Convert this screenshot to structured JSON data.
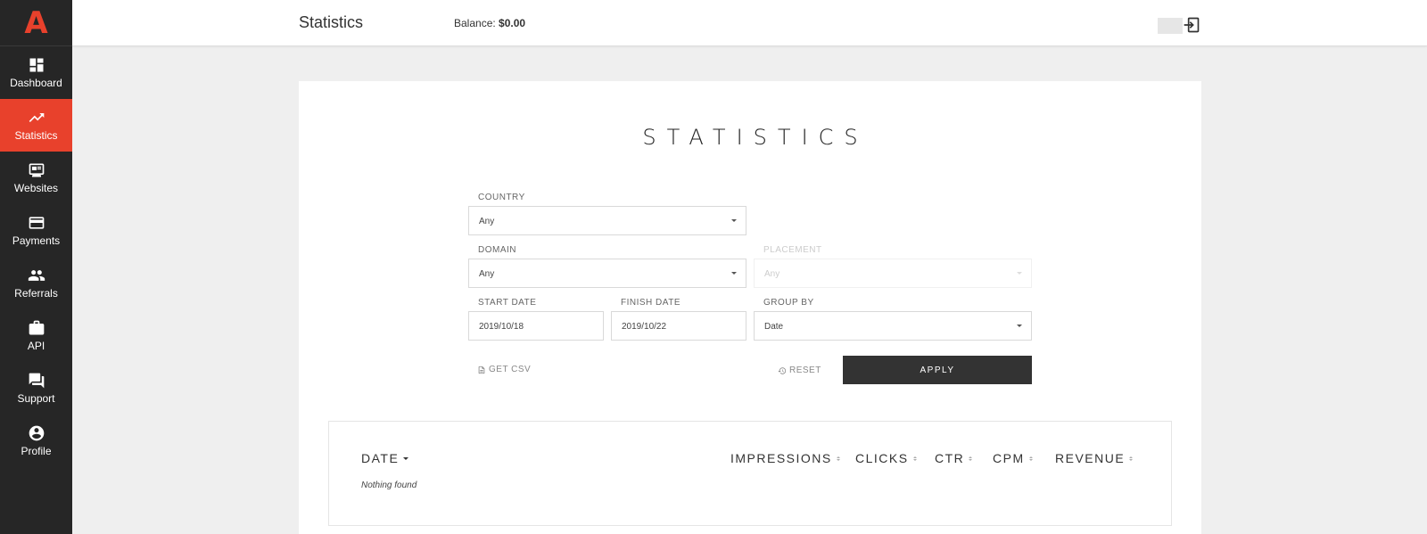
{
  "app": {
    "logo_letter": "A",
    "brand_color": "#e8412c"
  },
  "sidebar": {
    "items": [
      {
        "label": "Dashboard",
        "icon": "dashboard-icon",
        "active": false
      },
      {
        "label": "Statistics",
        "icon": "trending-up-icon",
        "active": true
      },
      {
        "label": "Websites",
        "icon": "website-icon",
        "active": false
      },
      {
        "label": "Payments",
        "icon": "credit-card-icon",
        "active": false
      },
      {
        "label": "Referrals",
        "icon": "people-icon",
        "active": false
      },
      {
        "label": "API",
        "icon": "briefcase-icon",
        "active": false
      },
      {
        "label": "Support",
        "icon": "chat-icon",
        "active": false
      },
      {
        "label": "Profile",
        "icon": "account-icon",
        "active": false
      }
    ]
  },
  "header": {
    "title": "Statistics",
    "balance_label": "Balance:",
    "balance_value": "$0.00",
    "logout_icon": "logout-icon"
  },
  "main": {
    "title": "STATISTICS",
    "filters": {
      "country": {
        "label": "COUNTRY",
        "value": "Any"
      },
      "domain": {
        "label": "DOMAIN",
        "value": "Any"
      },
      "placement": {
        "label": "PLACEMENT",
        "value": "Any",
        "disabled": true
      },
      "start_date": {
        "label": "START DATE",
        "value": "2019/10/18"
      },
      "finish_date": {
        "label": "FINISH DATE",
        "value": "2019/10/22"
      },
      "group_by": {
        "label": "GROUP BY",
        "value": "Date"
      }
    },
    "actions": {
      "get_csv": "GET CSV",
      "reset": "RESET",
      "apply": "APPLY"
    },
    "table": {
      "columns": [
        "DATE",
        "IMPRESSIONS",
        "CLICKS",
        "CTR",
        "CPM",
        "REVENUE"
      ],
      "empty_message": "Nothing found"
    }
  }
}
